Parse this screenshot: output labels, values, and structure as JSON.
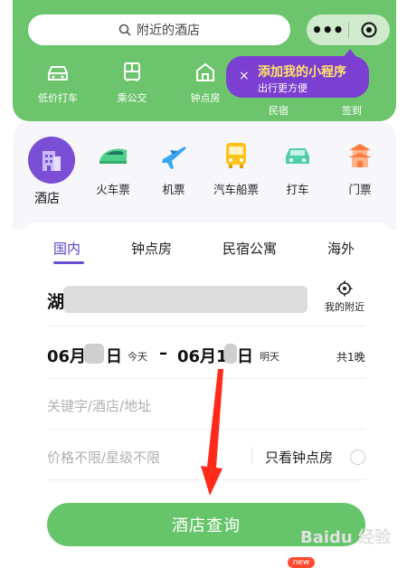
{
  "colors": {
    "primary_green": "#66c46a",
    "purple": "#7a4fd6",
    "tip_yellow": "#ffe26a"
  },
  "search": {
    "placeholder": "附近的酒店"
  },
  "capsule": {
    "menu_icon": "more-dots-icon",
    "close_icon": "target-icon"
  },
  "quick_nav": [
    {
      "label": "低价打车",
      "icon": "car-icon"
    },
    {
      "label": "乘公交",
      "icon": "bus-icon"
    },
    {
      "label": "钟点房",
      "icon": "house-icon"
    },
    {
      "label": "民宿",
      "icon": "home-icon"
    },
    {
      "label": "签到",
      "icon": "checkin-icon"
    }
  ],
  "tooltip": {
    "close": "×",
    "title": "添加我的小程序",
    "subtitle": "出行更方便"
  },
  "categories": [
    {
      "label": "酒店",
      "icon": "hotel-icon"
    },
    {
      "label": "火车票",
      "icon": "train-icon"
    },
    {
      "label": "机票",
      "icon": "plane-icon"
    },
    {
      "label": "汽车船票",
      "icon": "bus-icon"
    },
    {
      "label": "打车",
      "icon": "taxi-icon"
    },
    {
      "label": "门票",
      "icon": "temple-icon"
    }
  ],
  "tabs": [
    {
      "label": "国内",
      "active": true
    },
    {
      "label": "钟点房",
      "active": false
    },
    {
      "label": "民宿公寓",
      "active": false
    },
    {
      "label": "海外",
      "active": false
    }
  ],
  "location": {
    "city": "湖",
    "nearby_label": "我的附近"
  },
  "dates": {
    "checkin": "06月",
    "checkin_suffix": "日",
    "checkin_day": "今天",
    "dash": "–",
    "checkout": "06月1",
    "checkout_suffix": "日",
    "checkout_day": "明天",
    "nights": "共1晚"
  },
  "keyword": {
    "placeholder": "关键字/酒店/地址"
  },
  "filters": {
    "price_star": "价格不限/星级不限",
    "hourly_only": "只看钟点房"
  },
  "search_button": {
    "label": "酒店查询"
  },
  "badge": {
    "label": "new"
  },
  "watermark": {
    "text": "Baidu 经验"
  }
}
